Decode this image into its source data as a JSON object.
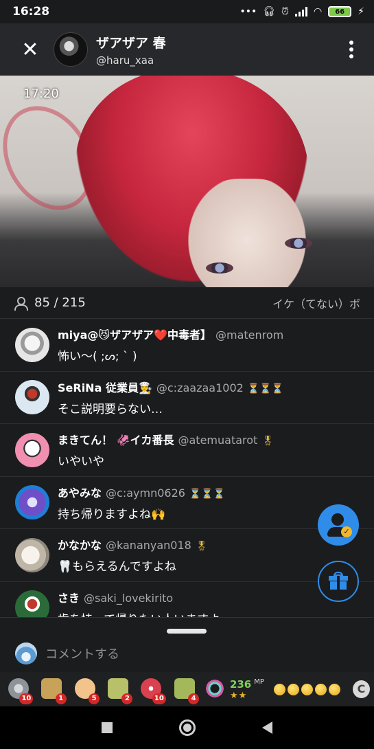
{
  "status": {
    "time": "16:28",
    "battery": "66",
    "icons": [
      "more-dots-icon",
      "headphones-icon",
      "alarm-icon",
      "signal-icon",
      "wifi-icon",
      "battery-icon",
      "charging-icon"
    ]
  },
  "header": {
    "host_name": "ザアザア 春",
    "host_handle": "@haru_xaa"
  },
  "video": {
    "timestamp": "17:20"
  },
  "viewers": {
    "count": "85 / 215",
    "stream_title": "イケ（てない）ボ"
  },
  "comments": [
    {
      "name": "miya@😼ザアザア❤️中毒者】",
      "handle": "@matenrom",
      "badge": "",
      "text": "怖い〜( ;ᔕ; ` )",
      "avatar_color": "#e6e6e6"
    },
    {
      "name": "SeRiNa 従業員👨‍🍳",
      "handle": "@c:zaazaa1002",
      "badge": "⏳⏳⏳",
      "text": "そこ説明要らない…",
      "avatar_color": "#dbe8f2"
    },
    {
      "name": "まきてん！ 🦑イカ番長",
      "handle": "@atemuatarot",
      "badge": "🎖",
      "text": "いやいや",
      "avatar_color": "#f08fb0"
    },
    {
      "name": "あやみな",
      "handle": "@c:aymn0626",
      "badge": "⏳⏳⏳",
      "text": "持ち帰りますよね🙌",
      "avatar_color": "#6f4fc8"
    },
    {
      "name": "かなかな",
      "handle": "@kananyan018",
      "badge": "🎖",
      "text": "🦷もらえるんですよね",
      "avatar_color": "#d9d3c8"
    },
    {
      "name": "さき",
      "handle": "@saki_lovekirito",
      "badge": "",
      "text": "歯を持って帰りたい人いますよー",
      "avatar_color": "#2b6b3a"
    }
  ],
  "input": {
    "placeholder": "コメントする"
  },
  "gifts": [
    {
      "name": "disc-gift",
      "count": "10",
      "color": "#9ea3a8"
    },
    {
      "name": "tea-gift",
      "count": "1",
      "color": "#c9a25a"
    },
    {
      "name": "clap-gift",
      "count": "5",
      "color": "#f2c48b"
    },
    {
      "name": "tea-can-gift",
      "count": "2",
      "color": "#b8c06a"
    },
    {
      "name": "meat-gift",
      "count": "10",
      "color": "#d9414f"
    },
    {
      "name": "green-tea-gift",
      "count": "4",
      "color": "#a3b85a"
    }
  ],
  "mp": {
    "value": "236",
    "unit": "MP",
    "stars": "★★"
  },
  "coins": {
    "count": 5,
    "currency_label": "C"
  }
}
